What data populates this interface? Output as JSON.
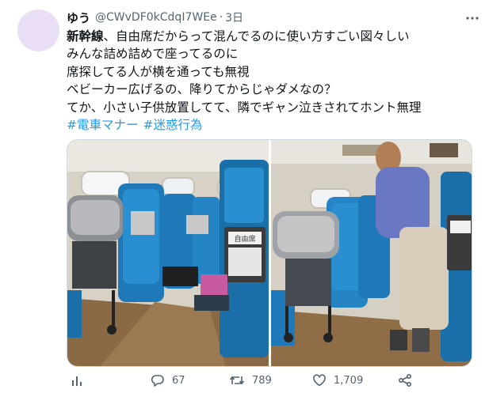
{
  "user": {
    "display_name": "ゆう",
    "handle": "@CWvDF0kCdqI7WEe",
    "separator": "·",
    "time": "3日"
  },
  "tweet": {
    "lines": [
      "新幹線、自由席だからって混んでるのに使い方すごい図々しい",
      "みんな詰め詰めで座ってるのに",
      "席探してる人が横を通っても無視",
      "ベビーカー広げるの、降りてからじゃダメなの？",
      "てか、小さい子供放置してて、隣でギャン泣きされてホント無理"
    ],
    "first_word": "新幹線",
    "first_rest": "、自由席だからって混んでるのに使い方すごい図々しい",
    "hashtags": [
      "#電車マナー",
      "#迷惑行為"
    ]
  },
  "media": {
    "photos": [
      {
        "alt_icon": "train-interior-photo-left"
      },
      {
        "alt_icon": "train-interior-photo-right"
      }
    ],
    "sign_text": "自由席"
  },
  "actions": {
    "views_icon": "analytics-icon",
    "replies": "67",
    "retweets": "789",
    "likes": "1,709",
    "share_icon": "share-icon"
  },
  "colors": {
    "link": "#1d9bf0",
    "secondary": "#536471",
    "text": "#0f1419",
    "avatar": "#e9def4"
  }
}
